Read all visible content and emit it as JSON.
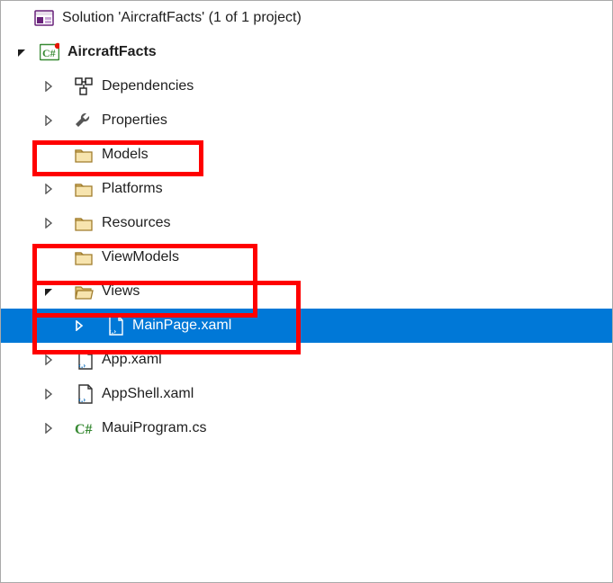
{
  "solution": {
    "label": "Solution 'AircraftFacts' (1 of 1 project)"
  },
  "project": {
    "label": "AircraftFacts"
  },
  "nodes": {
    "dependencies": "Dependencies",
    "properties": "Properties",
    "models": "Models",
    "platforms": "Platforms",
    "resources": "Resources",
    "viewmodels": "ViewModels",
    "views": "Views",
    "mainpage": "MainPage.xaml",
    "app": "App.xaml",
    "appshell": "AppShell.xaml",
    "mauiprogram": "MauiProgram.cs"
  },
  "colors": {
    "selection": "#0078d7",
    "highlight": "#ff0000",
    "folderFill": "#f2cf79",
    "folderStroke": "#a07c2c",
    "purple": "#68217a",
    "green": "#388a34"
  }
}
